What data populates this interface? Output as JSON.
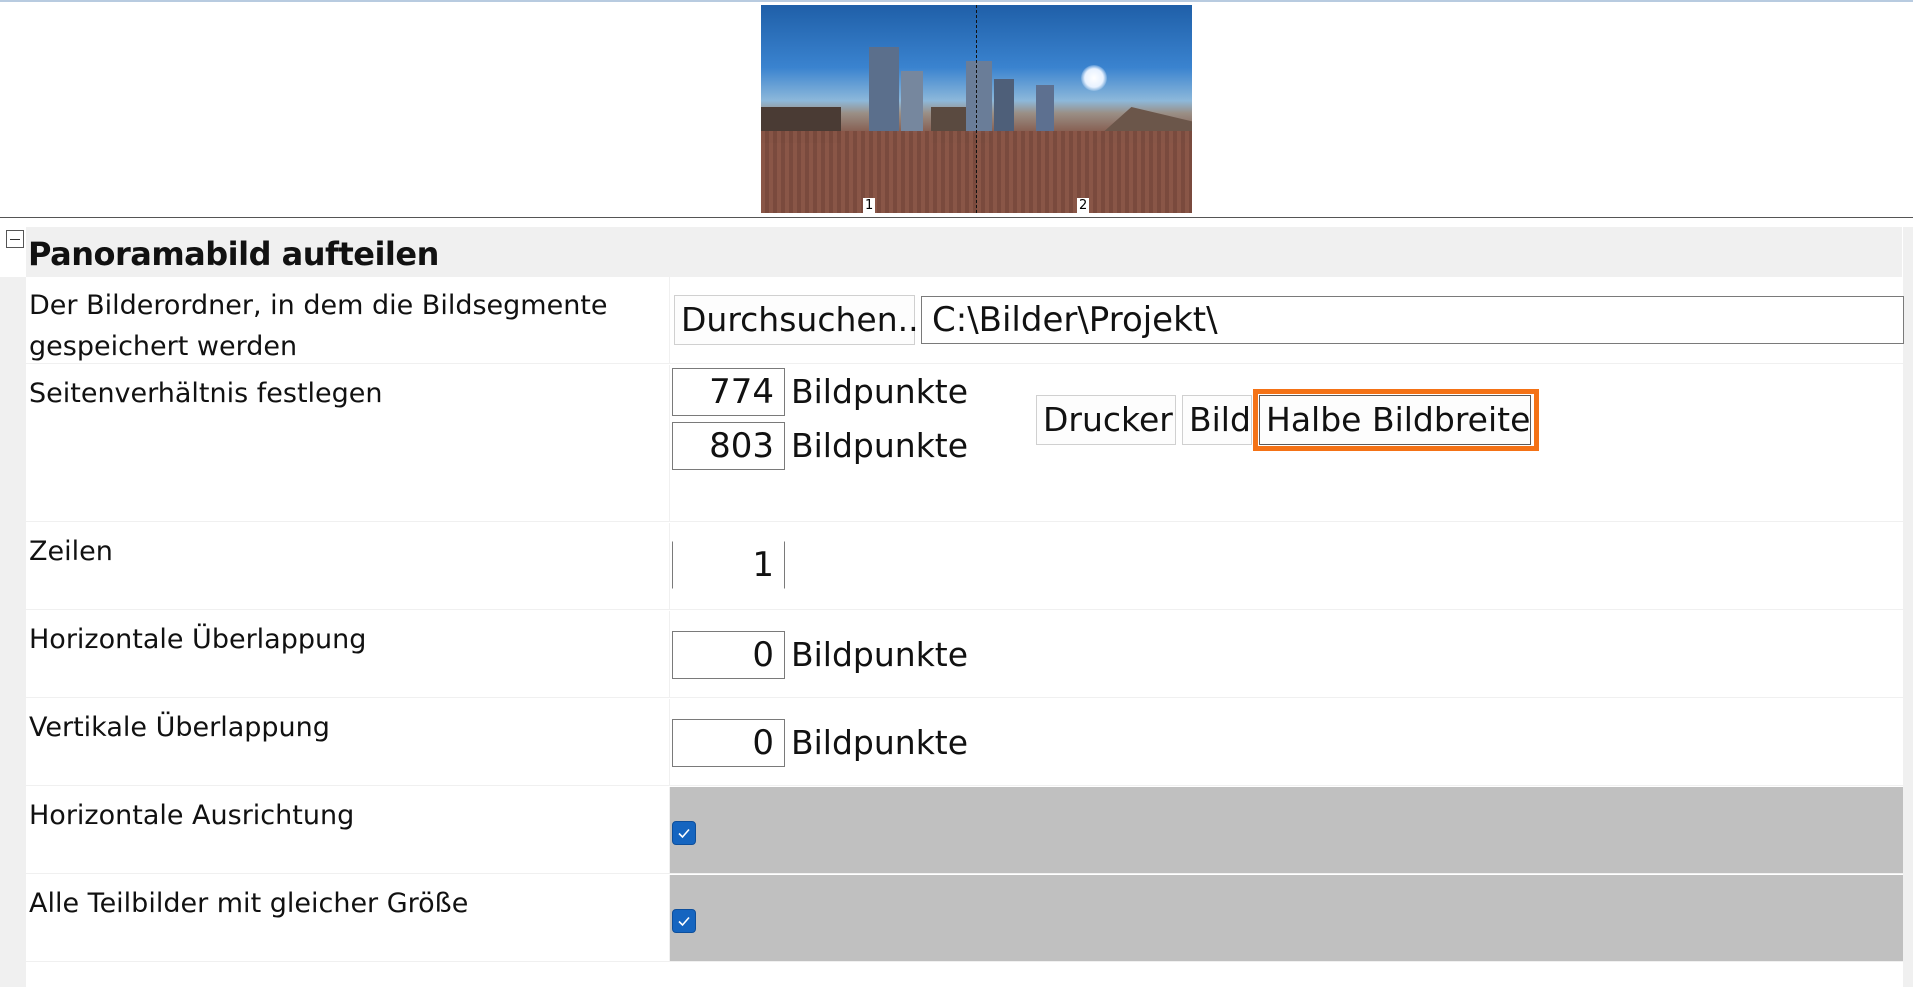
{
  "preview": {
    "segment_labels": [
      "1",
      "2"
    ]
  },
  "category": {
    "title": "Panoramabild aufteilen"
  },
  "rows": {
    "folder": {
      "label": "Der Bilderordner, in dem die Bildsegmente gespeichert werden",
      "browse_button": "Durchsuchen...",
      "path_value": "C:\\Bilder\\Projekt\\"
    },
    "aspect": {
      "label": "Seitenverhältnis festlegen",
      "width_value": "774",
      "height_value": "803",
      "unit": "Bildpunkte",
      "buttons": [
        "Drucker",
        "Bild",
        "Halbe Bildbreite"
      ]
    },
    "zeilen": {
      "label": "Zeilen",
      "value": "1"
    },
    "h_overlap": {
      "label": "Horizontale Überlappung",
      "value": "0",
      "unit": "Bildpunkte"
    },
    "v_overlap": {
      "label": "Vertikale Überlappung",
      "value": "0",
      "unit": "Bildpunkte"
    },
    "h_align": {
      "label": "Horizontale Ausrichtung",
      "checked": true
    },
    "same_size": {
      "label": "Alle Teilbilder mit gleicher Größe",
      "checked": true
    }
  },
  "colors": {
    "highlight": "#f47216",
    "checkbox": "#1565c0",
    "category_bg": "#f0f0f0",
    "disabled_value_bg": "#c0c0c0"
  }
}
